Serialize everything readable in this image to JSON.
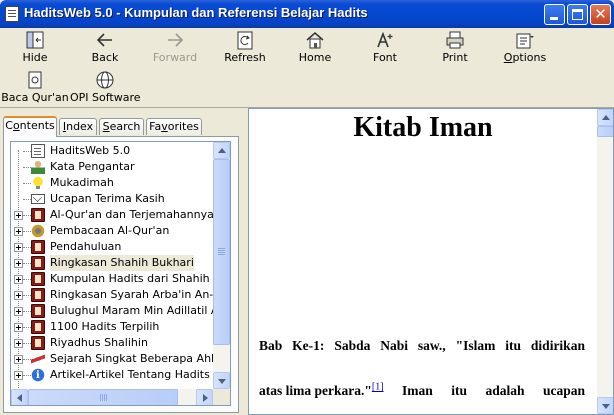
{
  "window": {
    "title": "HaditsWeb 5.0 - Kumpulan dan Referensi Belajar Hadits"
  },
  "toolbar": {
    "hide": "Hide",
    "back": "Back",
    "forward": "Forward",
    "refresh": "Refresh",
    "home": "Home",
    "font": "Font",
    "print": "Print",
    "options": "Options",
    "baca_quran": "Baca Qur'an",
    "opi_software": "OPI Software"
  },
  "tabs": {
    "contents": "Contents",
    "index": "Index",
    "search": "Search",
    "favorites": "Favorites",
    "active": "contents"
  },
  "tree": [
    {
      "label": "HaditsWeb 5.0",
      "icon": "document-icon",
      "expandable": false
    },
    {
      "label": "Kata Pengantar",
      "icon": "people-icon",
      "expandable": false
    },
    {
      "label": "Mukadimah",
      "icon": "lightbulb-icon",
      "expandable": false
    },
    {
      "label": "Ucapan Terima Kasih",
      "icon": "envelope-icon",
      "expandable": false
    },
    {
      "label": "Al-Qur'an dan Terjemahannya",
      "icon": "book-icon",
      "expandable": true
    },
    {
      "label": "Pembacaan Al-Qur'an",
      "icon": "gear-icon",
      "expandable": true
    },
    {
      "label": "Pendahuluan",
      "icon": "book-icon",
      "expandable": true
    },
    {
      "label": "Ringkasan Shahih Bukhari",
      "icon": "book-icon",
      "expandable": true,
      "selected": true
    },
    {
      "label": "Kumpulan Hadits dari Shahih Muslim",
      "icon": "book-icon",
      "expandable": true
    },
    {
      "label": "Ringkasan Syarah Arba'in An-Nawawi",
      "icon": "book-icon",
      "expandable": true
    },
    {
      "label": "Bulughul Maram Min Adillatil Ahkam",
      "icon": "book-icon",
      "expandable": true
    },
    {
      "label": "1100 Hadits Terpilih",
      "icon": "book-icon",
      "expandable": true
    },
    {
      "label": "Riyadhus Shalihin",
      "icon": "book-icon",
      "expandable": true
    },
    {
      "label": "Sejarah Singkat Beberapa Ahli Hadits",
      "icon": "walking-person-icon",
      "expandable": true
    },
    {
      "label": "Artikel-Artikel Tentang Hadits",
      "icon": "info-icon",
      "expandable": true
    }
  ],
  "content": {
    "title": "Kitab Iman",
    "line1": [
      "Bab",
      "Ke-1:",
      "Sabda",
      "Nabi",
      "saw.,",
      "\"Islam",
      "itu",
      "didirikan"
    ],
    "line2_start": "atas lima perkara.\"",
    "footnote": "[1]",
    "line2_end": [
      "Iman",
      "itu",
      "adalah",
      "ucapan"
    ]
  },
  "scroll": {
    "tree_v_position": 0,
    "tree_h_position": 0,
    "content_v_position": 0
  },
  "colors": {
    "titlebar": "#0548d0",
    "tab_accent": "#e68b2c",
    "link": "#0000cc"
  }
}
